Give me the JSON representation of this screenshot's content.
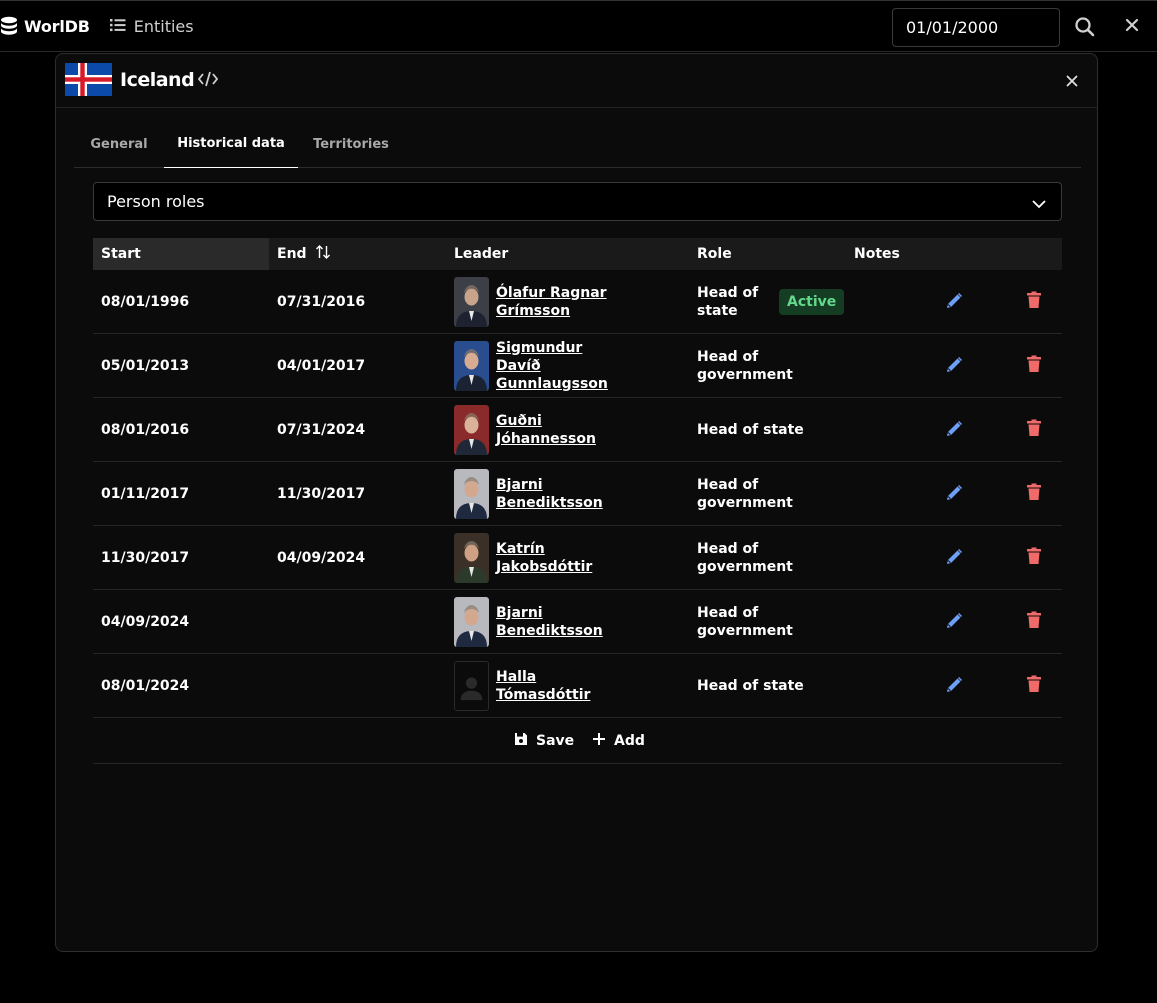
{
  "topbar": {
    "brand": "WorlDB",
    "nav_entities": "Entities",
    "date_value": "01/01/2000"
  },
  "modal": {
    "title": "Iceland",
    "tabs": [
      {
        "label": "General"
      },
      {
        "label": "Historical data"
      },
      {
        "label": "Territories"
      }
    ],
    "select_value": "Person roles",
    "columns": {
      "start": "Start",
      "end": "End",
      "leader": "Leader",
      "role": "Role",
      "notes": "Notes"
    },
    "rows": [
      {
        "start": "08/01/1996",
        "end": "07/31/2016",
        "leader": "Ólafur Ragnar Grímsson",
        "role": "Head of state",
        "badge": "Active"
      },
      {
        "start": "05/01/2013",
        "end": "04/01/2017",
        "leader": "Sigmundur Davíð Gunnlaugsson",
        "role": "Head of government"
      },
      {
        "start": "08/01/2016",
        "end": "07/31/2024",
        "leader": "Guðni Jóhannesson",
        "role": "Head of state"
      },
      {
        "start": "01/11/2017",
        "end": "11/30/2017",
        "leader": "Bjarni Benediktsson",
        "role": "Head of government"
      },
      {
        "start": "11/30/2017",
        "end": "04/09/2024",
        "leader": "Katrín Jakobsdóttir",
        "role": "Head of government"
      },
      {
        "start": "04/09/2024",
        "end": "",
        "leader": "Bjarni Benediktsson",
        "role": "Head of government"
      },
      {
        "start": "08/01/2024",
        "end": "",
        "leader": "Halla Tómasdóttir",
        "role": "Head of state"
      }
    ],
    "save_label": "Save",
    "add_label": "Add"
  },
  "colors": {
    "edit_icon": "#6f9ef5",
    "delete_icon": "#f06a6a",
    "active_badge_bg": "#143d24",
    "active_badge_fg": "#64d98b"
  }
}
